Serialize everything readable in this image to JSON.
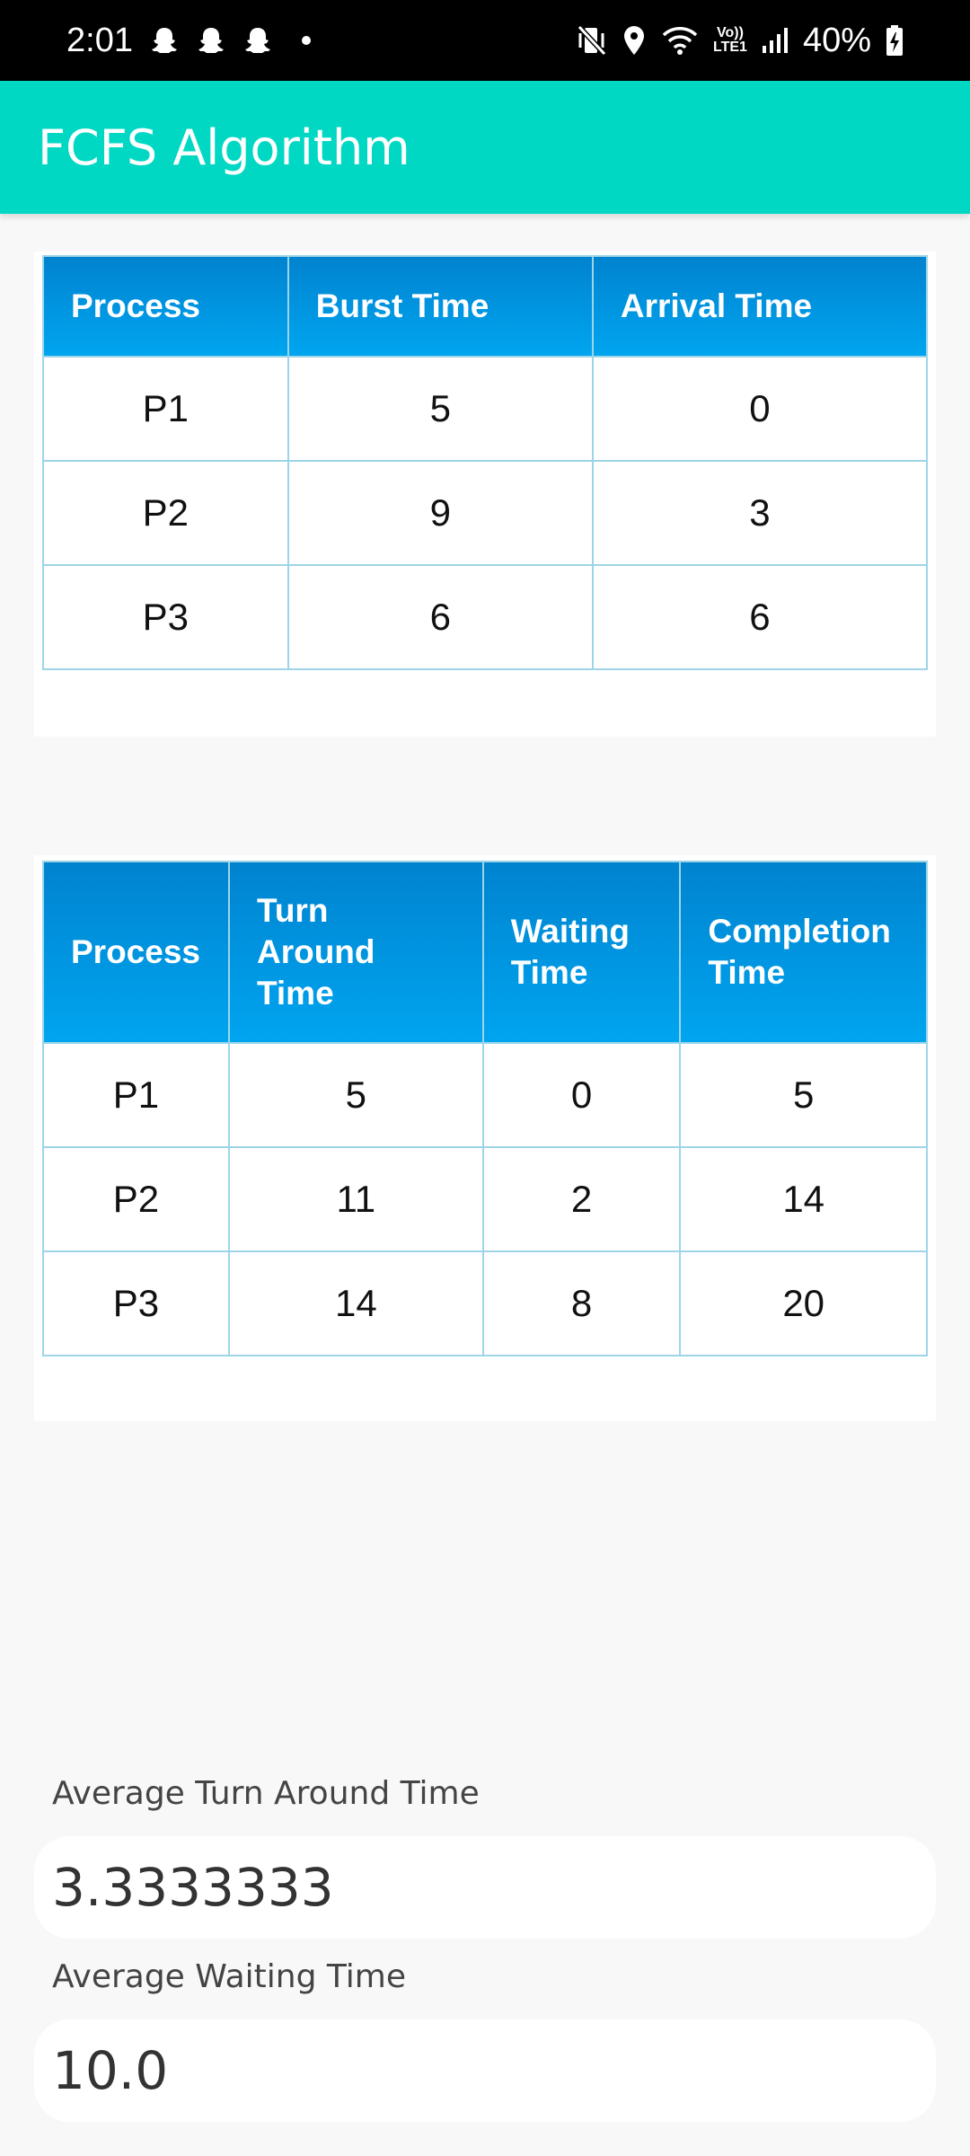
{
  "status_bar": {
    "time": "2:01",
    "battery": "40%",
    "network_top": "Vo))",
    "network_bottom": "LTE1"
  },
  "app_bar": {
    "title": "FCFS Algorithm"
  },
  "input_table": {
    "headers": [
      "Process",
      "Burst Time",
      "Arrival Time"
    ],
    "rows": [
      [
        "P1",
        "5",
        "0"
      ],
      [
        "P2",
        "9",
        "3"
      ],
      [
        "P3",
        "6",
        "6"
      ]
    ]
  },
  "result_table": {
    "headers": [
      "Process",
      "Turn Around Time",
      "Waiting Time",
      "Completion Time"
    ],
    "rows": [
      [
        "P1",
        "5",
        "0",
        "5"
      ],
      [
        "P2",
        "11",
        "2",
        "14"
      ],
      [
        "P3",
        "14",
        "8",
        "20"
      ]
    ]
  },
  "averages": {
    "tat_label": "Average Turn Around Time",
    "tat_value": "3.3333333",
    "wt_label": "Average Waiting Time",
    "wt_value": "10.0"
  },
  "colors": {
    "app_bar": "#00d8c4",
    "table_header_top": "#0083cf",
    "table_header_bottom": "#00a5f0",
    "table_border": "#9dd5e8"
  }
}
